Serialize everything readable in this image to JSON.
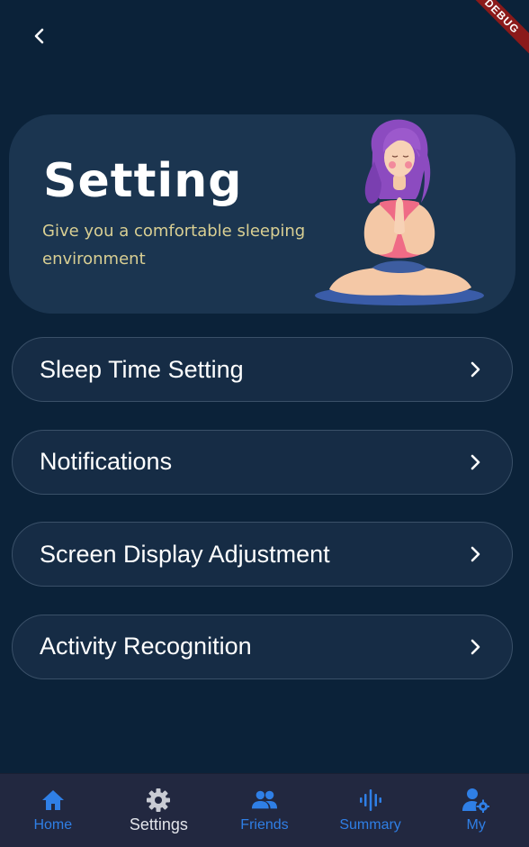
{
  "header": {
    "back_icon": "chevron-left-icon",
    "debug_banner": "DEBUG"
  },
  "banner": {
    "title": "Setting",
    "subtitle": "Give you a comfortable sleeping environment",
    "illustration": "meditating-woman-illustration"
  },
  "menu": {
    "items": [
      {
        "label": "Sleep Time Setting",
        "icon": "chevron-right-icon"
      },
      {
        "label": "Notifications",
        "icon": "chevron-right-icon"
      },
      {
        "label": "Screen Display Adjustment",
        "icon": "chevron-right-icon"
      },
      {
        "label": "Activity Recognition",
        "icon": "chevron-right-icon"
      }
    ]
  },
  "bottom_nav": {
    "items": [
      {
        "label": "Home",
        "icon": "home-icon",
        "active": false
      },
      {
        "label": "Settings",
        "icon": "gear-icon",
        "active": true
      },
      {
        "label": "Friends",
        "icon": "people-icon",
        "active": false
      },
      {
        "label": "Summary",
        "icon": "waveform-icon",
        "active": false
      },
      {
        "label": "My",
        "icon": "user-settings-icon",
        "active": false
      }
    ]
  },
  "colors": {
    "background": "#0b2239",
    "card": "#1b3550",
    "menu_item": "#162c45",
    "nav_background": "#222840",
    "nav_accent": "#2f7fe6",
    "subtitle": "#d9cf93",
    "debug_ribbon": "#8b1a1a"
  }
}
